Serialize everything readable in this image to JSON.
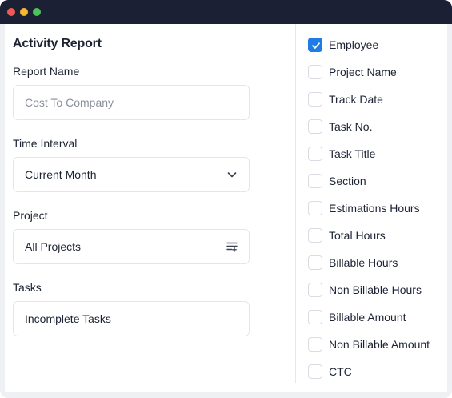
{
  "window": {
    "controls": [
      "close",
      "minimize",
      "maximize"
    ]
  },
  "report": {
    "title": "Activity Report",
    "report_name": {
      "label": "Report Name",
      "value": "",
      "placeholder": "Cost To Company"
    },
    "time_interval": {
      "label": "Time Interval",
      "selected": "Current Month",
      "icon": "chevron-down-icon"
    },
    "project": {
      "label": "Project",
      "selected": "All Projects",
      "icon": "filter-list-icon"
    },
    "tasks": {
      "label": "Tasks",
      "selected": "Incomplete Tasks"
    }
  },
  "columns": [
    {
      "label": "Employee",
      "checked": true
    },
    {
      "label": "Project Name",
      "checked": false
    },
    {
      "label": "Track Date",
      "checked": false
    },
    {
      "label": "Task No.",
      "checked": false
    },
    {
      "label": "Task Title",
      "checked": false
    },
    {
      "label": "Section",
      "checked": false
    },
    {
      "label": "Estimations Hours",
      "checked": false
    },
    {
      "label": "Total Hours",
      "checked": false
    },
    {
      "label": "Billable Hours",
      "checked": false
    },
    {
      "label": "Non Billable Hours",
      "checked": false
    },
    {
      "label": "Billable Amount",
      "checked": false
    },
    {
      "label": "Non Billable Amount",
      "checked": false
    },
    {
      "label": "CTC",
      "checked": false
    }
  ],
  "colors": {
    "accent": "#1f7be6",
    "titlebar": "#1b2034",
    "text": "#1c2333",
    "border": "#e3e6ec"
  }
}
